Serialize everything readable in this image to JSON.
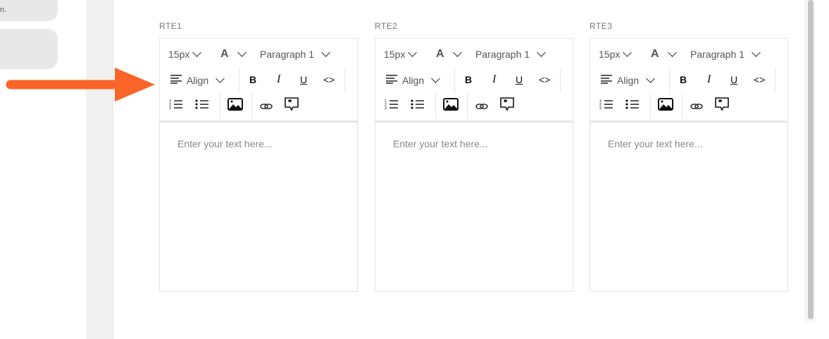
{
  "sidebar": {
    "truncated_text": "n."
  },
  "accent_color": "#fb6529",
  "toolbar": {
    "font_size": "15px",
    "font_icon": "A",
    "block_style": "Paragraph 1",
    "align": "Align",
    "bold": "B",
    "italic": "I",
    "underline": "U",
    "code": "<>"
  },
  "icons": [
    "align-left-icon",
    "ordered-list-icon",
    "bullet-list-icon",
    "image-icon",
    "link-icon",
    "quote-icon"
  ],
  "editors": [
    {
      "label": "RTE1",
      "placeholder": "Enter your text here..."
    },
    {
      "label": "RTE2",
      "placeholder": "Enter your text here..."
    },
    {
      "label": "RTE3",
      "placeholder": "Enter your text here..."
    }
  ]
}
